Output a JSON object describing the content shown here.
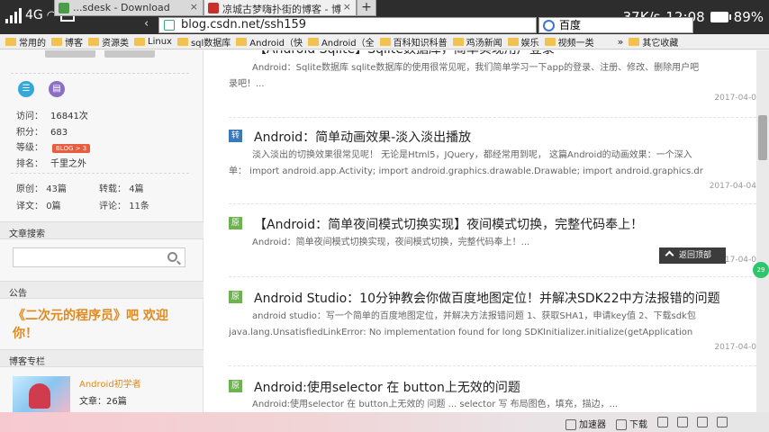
{
  "status_bar": {
    "network": "4G",
    "speed": "37K/s",
    "time": "12:08",
    "battery": "89%"
  },
  "tabs": [
    {
      "label": "...sdesk - Download",
      "favicon_color": "#4a9b4a"
    },
    {
      "label": "凉城古梦嗨扑街的博客 - 博",
      "favicon_color": "#c9302c"
    }
  ],
  "new_tab_label": "+",
  "address": {
    "url": "blog.csdn.net/ssh159",
    "search_engine": "百度"
  },
  "bookmarks": [
    "常用的",
    "博客",
    "资源类",
    "Linux",
    "sql数据库",
    "Android（快",
    "Android（全",
    "百科知识科普",
    "鸡汤新闻",
    "娱乐",
    "视频一类"
  ],
  "bookmarks_more": "»",
  "bookmarks_other": "其它收藏",
  "sidebar": {
    "stats": [
      {
        "label": "访问：",
        "value": "16841次"
      },
      {
        "label": "积分：",
        "value": "683"
      },
      {
        "label": "等级：",
        "value": "BLOG > 3"
      },
      {
        "label": "排名：",
        "value": "千里之外"
      }
    ],
    "counts": {
      "yuanchuang_label": "原创：",
      "yuanchuang_value": "43篇",
      "zhuanzai_label": "转载：",
      "zhuanzai_value": "4篇",
      "yiwen_label": "译文：",
      "yiwen_value": "0篇",
      "pinglun_label": "评论：",
      "pinglun_value": "11条"
    },
    "search_title": "文章搜索",
    "notice_title": "公告",
    "notice_text": "《二次元的程序员》吧 欢迎你！",
    "column_title": "博客专栏",
    "column_name": "Android初学者",
    "column_count": "文章：26篇"
  },
  "articles": [
    {
      "tag": "",
      "title": "【Android Sqlite】Sqlite数据库，简单实现用户登录",
      "desc_line1": "Android：Sqlite数据库 sqlite数据库的使用很常见呢，我们简单学习一下app的登录、注册、修改、删除用户吧",
      "desc_line2": "录吧！...",
      "date": "2017-04-0"
    },
    {
      "tag": "转",
      "title": "Android：简单动画效果-淡入淡出播放",
      "desc_line1": "淡入淡出的切换效果很常见呢！ 无论是Html5，JQuery，都经常用到呢， 这篇Android的动画效果：一个深入",
      "desc_line2": "单： import android.app.Activity; import android.graphics.drawable.Drawable; import android.graphics.dr",
      "date": "2017-04-04"
    },
    {
      "tag": "原",
      "title": "【Android：简单夜间模式切换实现】夜间模式切换，完整代码奉上！",
      "desc_line1": "Android：简单夜间模式切换实现，夜间模式切换，完整代码奉上！...",
      "desc_line2": "",
      "date": "2017-04-0"
    },
    {
      "tag": "原",
      "title": "Android Studio：10分钟教会你做百度地图定位！并解决SDK22中方法报错的问题",
      "desc_line1": "android studio：写一个简单的百度地图定位，并解决方法报错问题 1、获取SHA1，申请key值 2、下载sdk包",
      "desc_line2": "java.lang.UnsatisfiedLinkError: No implementation found for long SDKInitializer.initialize(getApplication",
      "date": "2017-04-0"
    },
    {
      "tag": "原",
      "title": "Android:使用selector 在 button上无效的问题",
      "desc_line1": "Android:使用selector 在 button上无效的 问题 ... selector 写 布局图色，填充，描边，...",
      "desc_line2": "",
      "date": ""
    }
  ],
  "back_to_top": "返回顶部",
  "side_badge": "29",
  "taskbar": {
    "accelerator": "加速器",
    "download": "下载"
  }
}
